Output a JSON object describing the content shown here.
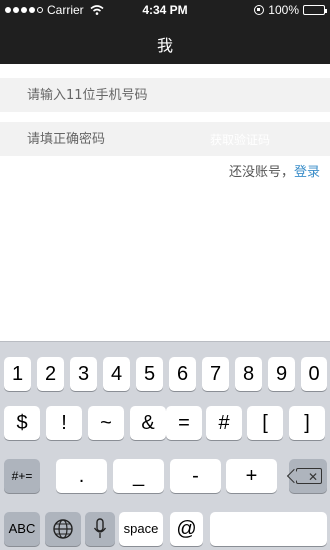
{
  "status_bar": {
    "carrier": "Carrier",
    "time": "4:34 PM",
    "battery": "100%",
    "battery_level": 1.0,
    "signal_bars_filled": 4,
    "signal_bars_total": 5
  },
  "nav": {
    "title": "我"
  },
  "form": {
    "phone_placeholder": "请输入11位手机号码",
    "code_placeholder": "请填正确密码",
    "code_button_label": "获取验证码"
  },
  "register": {
    "prompt": "还没账号，",
    "link": "登录"
  },
  "keyboard": {
    "row1": [
      "1",
      "2",
      "3",
      "4",
      "5",
      "6",
      "7",
      "8",
      "9",
      "0"
    ],
    "row2": [
      "$",
      "!",
      "~",
      "&",
      "=",
      "#",
      "[",
      "]"
    ],
    "row3_shift": "#+=",
    "row3": [
      ".",
      "_",
      "-",
      "+"
    ],
    "row4_abc": "ABC",
    "row4_space": "space",
    "row4_at": "@"
  },
  "colors": {
    "nav_bg": "#1f1f1f",
    "link": "#3b8ec9",
    "keyboard_bg": "#d2d5db"
  }
}
